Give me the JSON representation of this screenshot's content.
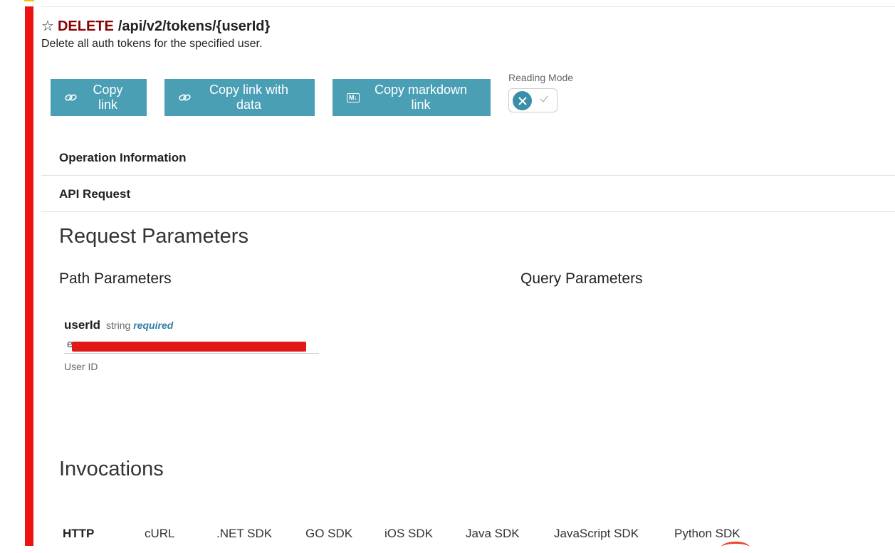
{
  "operation": {
    "method": "DELETE",
    "path": "/api/v2/tokens/{userId}",
    "description": "Delete all auth tokens for the specified user."
  },
  "toolbar": {
    "copy_link": "Copy link",
    "copy_link_with_data": "Copy link with data",
    "copy_markdown_link": "Copy markdown link",
    "md_badge": "M↓",
    "reading_mode_label": "Reading Mode"
  },
  "sections": {
    "operation_information": "Operation Information",
    "api_request": "API Request"
  },
  "request_parameters": {
    "title": "Request Parameters",
    "path_parameters_title": "Path Parameters",
    "query_parameters_title": "Query Parameters",
    "params": [
      {
        "name": "userId",
        "type": "string",
        "required_label": "required",
        "value": "e",
        "help": "User ID"
      }
    ]
  },
  "invocations": {
    "title": "Invocations",
    "tabs": [
      "HTTP",
      "cURL",
      ".NET SDK",
      "GO SDK",
      "iOS SDK",
      "Java SDK",
      "JavaScript SDK",
      "Python SDK"
    ],
    "active_tab": "HTTP"
  },
  "colors": {
    "accent_bar": "#ee1111",
    "method": "#8b0000",
    "button": "#4a9fb5",
    "toggle": "#3a8fa8"
  },
  "icons": {
    "favorite": "star-icon",
    "copy_link": "link-icon",
    "copy_link_with_data": "link-icon",
    "copy_markdown": "markdown-icon",
    "toggle_off": "close-icon",
    "toggle_on": "check-icon"
  }
}
